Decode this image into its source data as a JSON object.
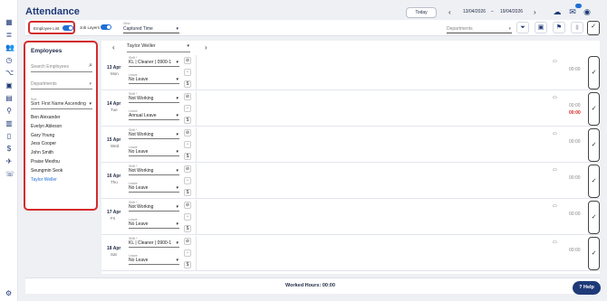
{
  "app": {
    "title": "Attendance"
  },
  "rail": {
    "icons": [
      "dashboard-icon",
      "list-icon",
      "people-icon",
      "clock-icon",
      "org-chart-icon",
      "clipboard-icon",
      "calendar-icon",
      "location-pin-icon",
      "building-icon",
      "document-icon",
      "dollar-icon",
      "plane-icon",
      "phone-icon"
    ],
    "settings_icon": "gear-icon"
  },
  "header": {
    "today_label": "Today",
    "date_from": "13/04/2026",
    "date_sep": "–",
    "date_to": "19/04/2026",
    "notification_count": ""
  },
  "filters": {
    "employee_list_label": "Employee List",
    "employee_list_on": true,
    "job_layers_label": "Job Layers",
    "job_layers_on": true,
    "view_label": "View",
    "view_value": "Captured Time",
    "departments_placeholder": "Departments"
  },
  "employees_panel": {
    "title": "Employees",
    "search_placeholder": "Search Employees",
    "departments_placeholder": "Departments",
    "sort_label": "Sort",
    "sort_value": "Sort: First Name Ascending",
    "employees": [
      "Ben Alexander",
      "Evelyn Ableson",
      "Gary Young",
      "Jess Cooper",
      "John Smith",
      "Praise Mesfou",
      "Seungmin Seok",
      "Taylor Weller"
    ],
    "selected": "Taylor Weller"
  },
  "schedule": {
    "selected_employee": "Taylor Weller",
    "shift_label": "Shift *",
    "leave_label": "Leave",
    "days": [
      {
        "date": "13 Apr",
        "weekday": "Mon",
        "shift": "KL | Cleaner | 0900-1",
        "leave": "No Leave",
        "hours": "00:00",
        "hours_alert": false
      },
      {
        "date": "14 Apr",
        "weekday": "Tue",
        "shift": "Not Working",
        "leave": "Annual Leave",
        "hours": "00:00",
        "hours2": "00:00",
        "hours_alert": true
      },
      {
        "date": "15 Apr",
        "weekday": "Wed",
        "shift": "Not Working",
        "leave": "No Leave",
        "hours": "00:00",
        "hours_alert": false
      },
      {
        "date": "16 Apr",
        "weekday": "Thu",
        "shift": "Not Working",
        "leave": "No Leave",
        "hours": "00:00",
        "hours_alert": false
      },
      {
        "date": "17 Apr",
        "weekday": "Fri",
        "shift": "Not Working",
        "leave": "No Leave",
        "hours": "00:00",
        "hours_alert": false
      },
      {
        "date": "18 Apr",
        "weekday": "Sat",
        "shift": "KL | Cleaner | 0900-1",
        "leave": "No Leave",
        "hours": "00:00",
        "hours_alert": false
      }
    ]
  },
  "footer": {
    "worked_hours": "Worked Hours: 00:00",
    "help_label": "Help"
  },
  "colors": {
    "brand": "#1f3a78",
    "accent": "#1f6fd6",
    "highlight": "#d52b2b"
  }
}
